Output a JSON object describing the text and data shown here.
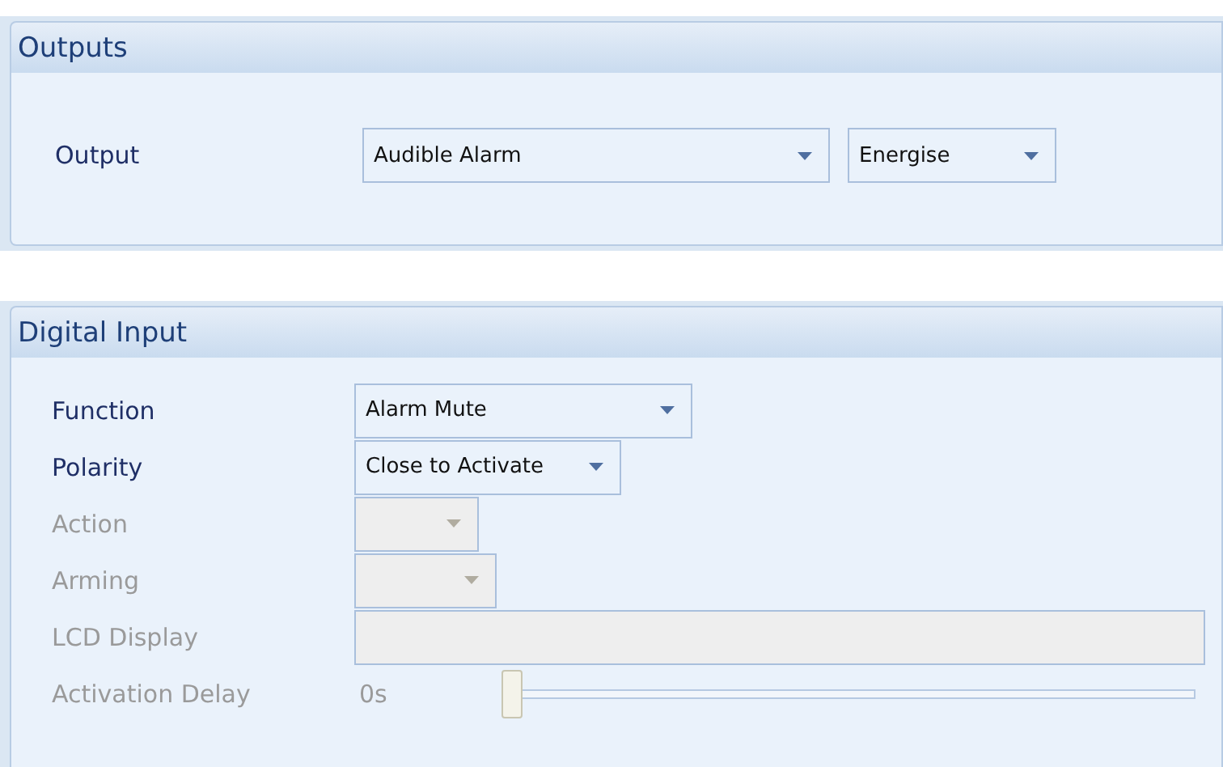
{
  "panels": [
    {
      "title": "Outputs",
      "rows": [
        {
          "kind": "output",
          "label": "Output",
          "value": "Audible Alarm",
          "value_2": "Energise"
        }
      ]
    },
    {
      "title": "Digital Input",
      "rows": [
        {
          "kind": "combo",
          "label": "Function",
          "disabled": false,
          "value": "Alarm Mute"
        },
        {
          "kind": "combo",
          "label": "Polarity",
          "disabled": false,
          "value": "Close to Activate"
        },
        {
          "kind": "combo",
          "label": "Action",
          "disabled": true
        },
        {
          "kind": "combo",
          "label": "Arming",
          "disabled": true
        },
        {
          "kind": "text",
          "label": "LCD Display",
          "disabled": true
        },
        {
          "kind": "slider",
          "label": "Activation Delay",
          "disabled": true,
          "reading": "0s",
          "level": 0
        }
      ]
    }
  ]
}
